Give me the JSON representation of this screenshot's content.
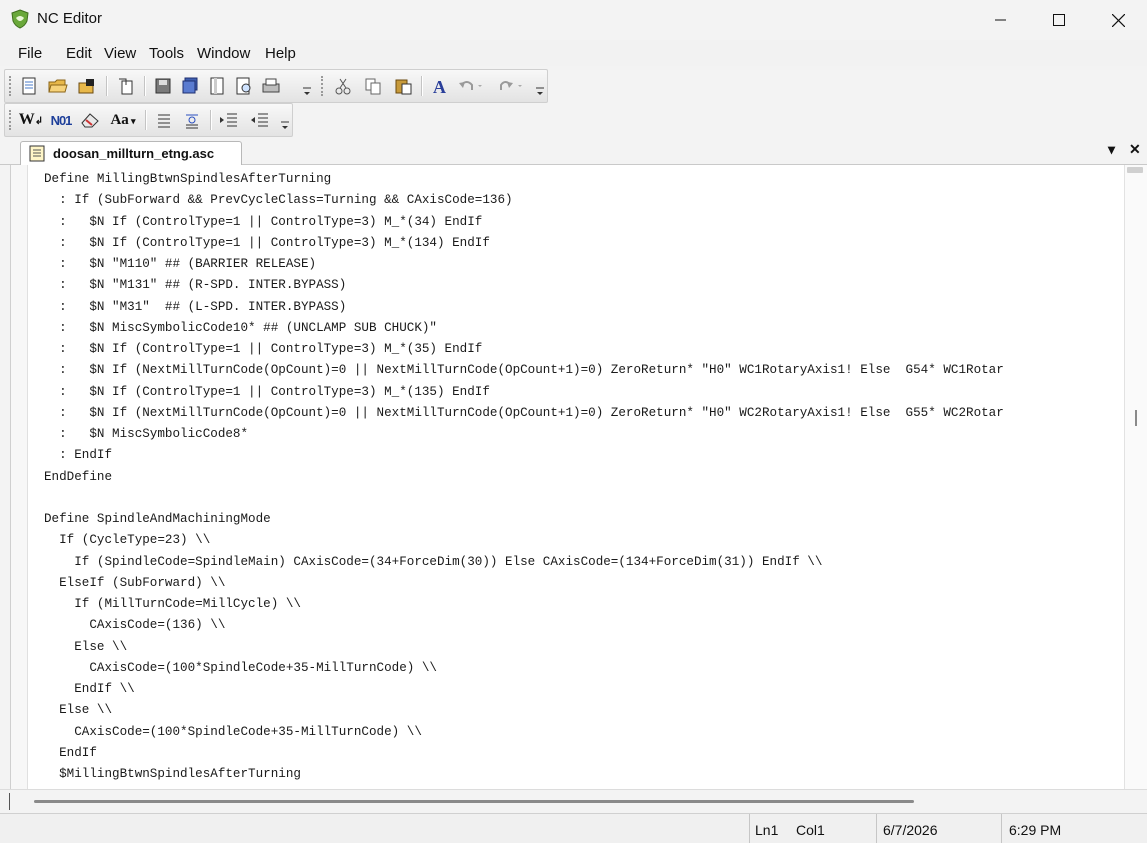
{
  "window": {
    "title": "NC Editor"
  },
  "menu": [
    "File",
    "Edit",
    "View",
    "Tools",
    "Window",
    "Help"
  ],
  "toolbar1": {
    "buttons": [
      "new-file-icon",
      "open-folder-icon",
      "open-lock-icon",
      "recent-files-icon",
      "save-icon",
      "save-all-icon",
      "page-setup-icon",
      "print-preview-icon",
      "print-icon",
      "cut-icon",
      "copy-icon",
      "paste-icon",
      "font-icon",
      "undo-icon",
      "redo-icon"
    ]
  },
  "toolbar2": {
    "labels": {
      "w": "W",
      "n": "N01",
      "aa": "Aa"
    }
  },
  "tab": {
    "filename": "doosan_millturn_etng.asc",
    "pin": "▾",
    "close": "✕"
  },
  "code_lines": [
    "Define MillingBtwnSpindlesAfterTurning",
    "  : If (SubForward && PrevCycleClass=Turning && CAxisCode=136)",
    "  :   $N If (ControlType=1 || ControlType=3) M_*(34) EndIf",
    "  :   $N If (ControlType=1 || ControlType=3) M_*(134) EndIf",
    "  :   $N \"M110\" ## (BARRIER RELEASE)",
    "  :   $N \"M131\" ## (R-SPD. INTER.BYPASS)",
    "  :   $N \"M31\"  ## (L-SPD. INTER.BYPASS)",
    "  :   $N MiscSymbolicCode10* ## (UNCLAMP SUB CHUCK)\"",
    "  :   $N If (ControlType=1 || ControlType=3) M_*(35) EndIf",
    "  :   $N If (NextMillTurnCode(OpCount)=0 || NextMillTurnCode(OpCount+1)=0) ZeroReturn* \"H0\" WC1RotaryAxis1! Else  G54* WC1Rotar",
    "  :   $N If (ControlType=1 || ControlType=3) M_*(135) EndIf",
    "  :   $N If (NextMillTurnCode(OpCount)=0 || NextMillTurnCode(OpCount+1)=0) ZeroReturn* \"H0\" WC2RotaryAxis1! Else  G55* WC2Rotar",
    "  :   $N MiscSymbolicCode8*",
    "  : EndIf",
    "EndDefine",
    "",
    "Define SpindleAndMachiningMode",
    "  If (CycleType=23) \\\\",
    "    If (SpindleCode=SpindleMain) CAxisCode=(34+ForceDim(30)) Else CAxisCode=(134+ForceDim(31)) EndIf \\\\",
    "  ElseIf (SubForward) \\\\",
    "    If (MillTurnCode=MillCycle) \\\\",
    "      CAxisCode=(136) \\\\",
    "    Else \\\\",
    "      CAxisCode=(100*SpindleCode+35-MillTurnCode) \\\\",
    "    EndIf \\\\",
    "  Else \\\\",
    "    CAxisCode=(100*SpindleCode+35-MillTurnCode) \\\\",
    "  EndIf",
    "  $MillingBtwnSpindlesAfterTurning"
  ],
  "status": {
    "line": "Ln1",
    "col": "Col1",
    "date": "6/7/2026",
    "time": "6:29 PM"
  }
}
